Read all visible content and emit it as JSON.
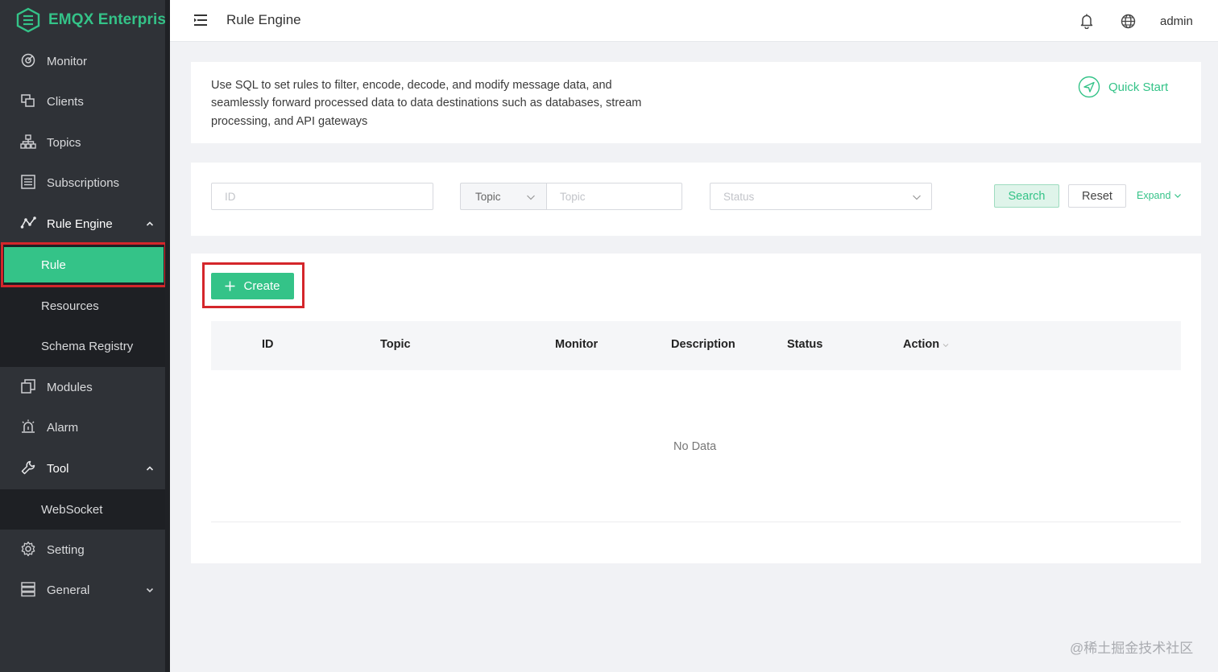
{
  "app": {
    "brand": "EMQX Enterprise",
    "brand_color": "#34c388",
    "sidebar_bg": "#2f3237",
    "highlight_color": "#d4262b"
  },
  "sidebar": {
    "items": [
      {
        "label": "Monitor",
        "icon": "monitor-icon"
      },
      {
        "label": "Clients",
        "icon": "clients-icon"
      },
      {
        "label": "Topics",
        "icon": "topics-icon"
      },
      {
        "label": "Subscriptions",
        "icon": "subscriptions-icon"
      },
      {
        "label": "Rule Engine",
        "icon": "rule-engine-icon",
        "expanded": true
      },
      {
        "label": "Modules",
        "icon": "modules-icon"
      },
      {
        "label": "Alarm",
        "icon": "alarm-icon"
      },
      {
        "label": "Tool",
        "icon": "tool-icon",
        "expanded": true
      },
      {
        "label": "Setting",
        "icon": "setting-icon"
      },
      {
        "label": "General",
        "icon": "general-icon",
        "expanded": false
      }
    ],
    "rule_engine_sub": [
      "Rule",
      "Resources",
      "Schema Registry"
    ],
    "tool_sub": [
      "WebSocket"
    ],
    "active": "Rule"
  },
  "header": {
    "title": "Rule Engine",
    "user": "admin"
  },
  "intro": {
    "text": "Use SQL to set rules to filter, encode, decode, and modify message data, and seamlessly forward processed data to data destinations such as databases, stream processing, and API gateways",
    "quick_start": "Quick Start"
  },
  "filters": {
    "id_placeholder": "ID",
    "topic_select": "Topic",
    "topic_placeholder": "Topic",
    "status_placeholder": "Status",
    "search": "Search",
    "reset": "Reset",
    "expand": "Expand"
  },
  "table": {
    "create": "Create",
    "columns": [
      "ID",
      "Topic",
      "Monitor",
      "Description",
      "Status",
      "Action"
    ],
    "empty": "No Data"
  },
  "watermark": "@稀土掘金技术社区"
}
